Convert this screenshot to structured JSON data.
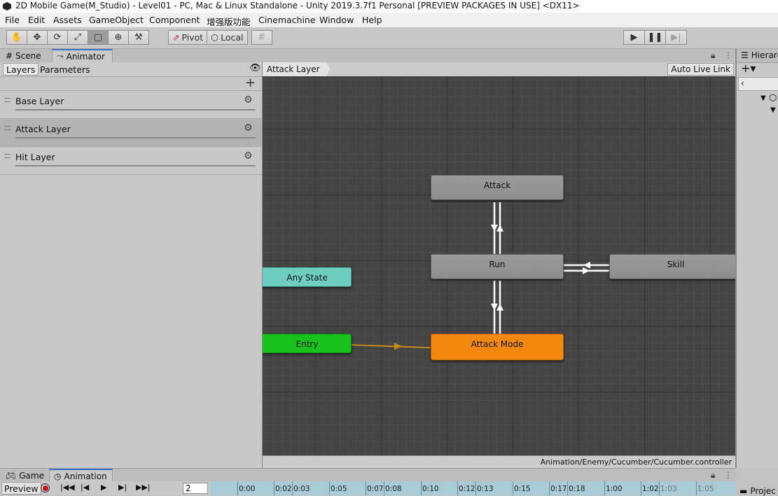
{
  "window": {
    "title": "2D Mobile Game(M_Studio) - Level01 - PC, Mac & Linux Standalone - Unity 2019.3.7f1 Personal [PREVIEW PACKAGES IN USE] <DX11>"
  },
  "menu": [
    "File",
    "Edit",
    "Assets",
    "GameObject",
    "Component",
    "增强版功能",
    "Cinemachine",
    "Window",
    "Help"
  ],
  "toolbar": {
    "pivot_label": "Pivot",
    "local_label": "Local"
  },
  "tabs": {
    "scene": "Scene",
    "animator": "Animator",
    "hierarchy": "Hierarc",
    "project": "Projec",
    "game": "Game",
    "animation": "Animation"
  },
  "layers_panel": {
    "tab_layers": "Layers",
    "tab_parameters": "Parameters",
    "layers": [
      {
        "name": "Base Layer",
        "selected": false
      },
      {
        "name": "Attack Layer",
        "selected": true
      },
      {
        "name": "Hit Layer",
        "selected": false
      }
    ]
  },
  "graph": {
    "breadcrumb": "Attack Layer",
    "auto_live_link": "Auto Live Link",
    "controller_path": "Animation/Enemy/Cucumber/Cucumber.controller",
    "states": {
      "attack": "Attack",
      "run": "Run",
      "skill": "Skill",
      "any_state": "Any State",
      "entry": "Entry",
      "attack_mode": "Attack Mode"
    },
    "default_state": "Attack Mode",
    "colors": {
      "state": "#929292",
      "any_state": "#6fcdc1",
      "entry": "#17c21a",
      "default_state": "#f3890e",
      "default_transition": "#c98a1a"
    }
  },
  "animation": {
    "preview_label": "Preview",
    "frame_value": "2",
    "ticks": [
      "0:00",
      "0:02",
      "0:03",
      "0:05",
      "0:07",
      "0:08",
      "0:10",
      "0:12",
      "0:13",
      "0:15",
      "0:17",
      "0:18",
      "1:00",
      "1:02",
      "1:03",
      "1:05"
    ]
  }
}
